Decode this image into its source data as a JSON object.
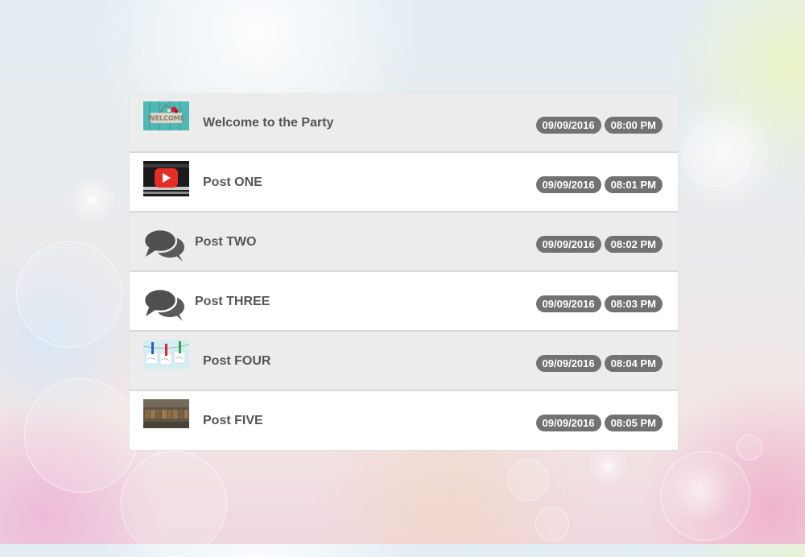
{
  "feed": {
    "items": [
      {
        "title": "Welcome to the Party",
        "date": "09/09/2016",
        "time": "08:00 PM",
        "thumbnail": "welcome-sign-image"
      },
      {
        "title": "Post ONE",
        "date": "09/09/2016",
        "time": "08:01 PM",
        "thumbnail": "youtube-video-thumbnail"
      },
      {
        "title": "Post TWO",
        "date": "09/09/2016",
        "time": "08:02 PM",
        "thumbnail": "chat-bubbles-icon"
      },
      {
        "title": "Post THREE",
        "date": "09/09/2016",
        "time": "08:03 PM",
        "thumbnail": "chat-bubbles-icon"
      },
      {
        "title": "Post FOUR",
        "date": "09/09/2016",
        "time": "08:04 PM",
        "thumbnail": "clothespin-notes-image"
      },
      {
        "title": "Post FIVE",
        "date": "09/09/2016",
        "time": "08:05 PM",
        "thumbnail": "wooden-letters-image"
      }
    ]
  },
  "colors": {
    "row_alt": "#ececec",
    "row": "#ffffff",
    "badge": "#727272",
    "title_text": "#555555"
  }
}
